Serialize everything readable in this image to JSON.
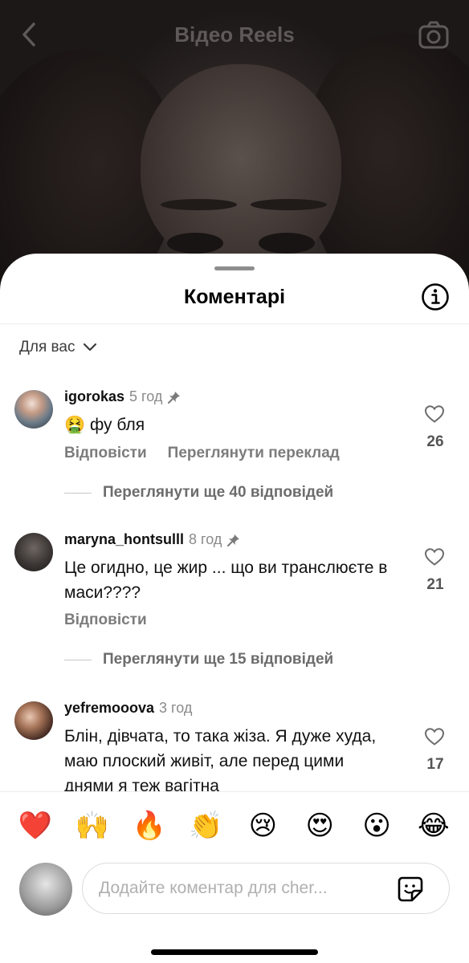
{
  "header": {
    "title": "Відео Reels",
    "back_icon": "chevron-left-icon",
    "camera_icon": "camera-icon"
  },
  "sheet": {
    "title": "Коментарі",
    "info_icon": "info-icon",
    "sort_label": "Для вас"
  },
  "comments": [
    {
      "username": "igorokas",
      "time": "5 год",
      "pinned": true,
      "text_emoji": "🤮",
      "text": "фу бля",
      "actions": [
        "Відповісти",
        "Переглянути переклад"
      ],
      "likes": "26",
      "view_replies": "Переглянути ще 40 відповідей"
    },
    {
      "username": "maryna_hontsulll",
      "time": "8 год",
      "pinned": true,
      "text": "Це огидно, це жир ... що ви транслюєте в маси????",
      "actions": [
        "Відповісти"
      ],
      "likes": "21",
      "view_replies": "Переглянути ще 15 відповідей"
    },
    {
      "username": "yefremooova",
      "time": "3 год",
      "pinned": false,
      "text": "Блін, дівчата, то така жіза. Я дуже худа, маю плоский живіт, але перед цими днями я теж вагітна",
      "likes": "17"
    }
  ],
  "reactions": [
    "❤️",
    "🙌",
    "🔥",
    "👏",
    "😢",
    "😍",
    "😮",
    "😂"
  ],
  "composer": {
    "placeholder": "Додайте коментар для cher...",
    "sticker_icon": "sticker-icon"
  },
  "colors": {
    "accent_text": "#000000",
    "muted_text": "#7c7c7c",
    "sheet_bg": "#ffffff"
  }
}
